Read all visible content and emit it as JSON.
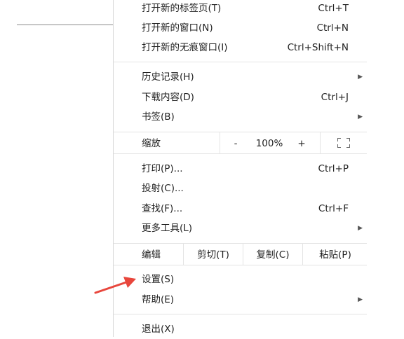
{
  "menu": {
    "group1": [
      {
        "label": "打开新的标签页(T)",
        "shortcut": "Ctrl+T"
      },
      {
        "label": "打开新的窗口(N)",
        "shortcut": "Ctrl+N"
      },
      {
        "label": "打开新的无痕窗口(I)",
        "shortcut": "Ctrl+Shift+N"
      }
    ],
    "group2": [
      {
        "label": "历史记录(H)",
        "shortcut": ""
      },
      {
        "label": "下载内容(D)",
        "shortcut": "Ctrl+J"
      },
      {
        "label": "书签(B)",
        "shortcut": ""
      }
    ],
    "zoom": {
      "label": "缩放",
      "minus": "-",
      "value": "100%",
      "plus": "+",
      "fullscreen_icon": "fullscreen-icon"
    },
    "group3": [
      {
        "label": "打印(P)...",
        "shortcut": "Ctrl+P"
      },
      {
        "label": "投射(C)...",
        "shortcut": ""
      },
      {
        "label": "查找(F)...",
        "shortcut": "Ctrl+F"
      },
      {
        "label": "更多工具(L)",
        "shortcut": ""
      }
    ],
    "edit": {
      "label": "编辑",
      "cut": "剪切(T)",
      "copy": "复制(C)",
      "paste": "粘贴(P)"
    },
    "group4": [
      {
        "label": "设置(S)"
      },
      {
        "label": "帮助(E)"
      }
    ],
    "exit": {
      "label": "退出(X)"
    }
  },
  "icons": {
    "submenu": "submenu-arrow-icon",
    "annotation": "red-arrow-icon"
  },
  "colors": {
    "annotation_arrow": "#e8463c",
    "text": "#222222",
    "separator": "#e4e4e4"
  }
}
